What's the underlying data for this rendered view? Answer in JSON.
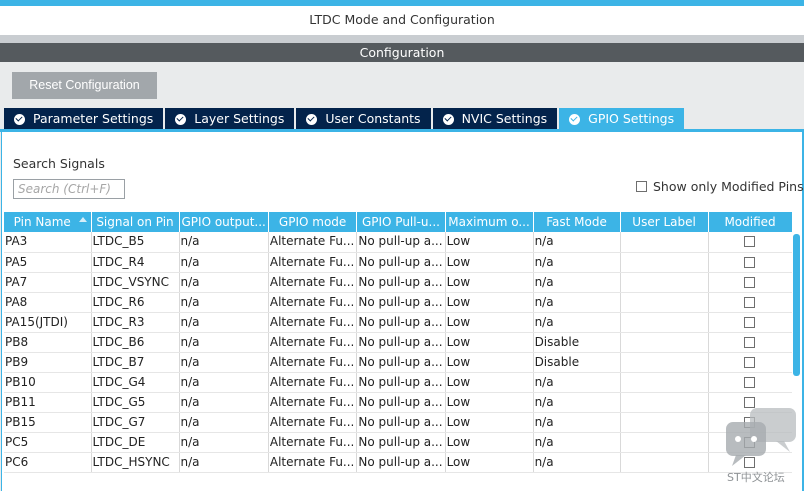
{
  "window": {
    "title": "LTDC Mode and Configuration"
  },
  "config_bar": {
    "label": "Configuration"
  },
  "toolbar": {
    "reset_label": "Reset Configuration"
  },
  "tabs": [
    {
      "label": "Parameter Settings",
      "active": false
    },
    {
      "label": "Layer Settings",
      "active": false
    },
    {
      "label": "User Constants",
      "active": false
    },
    {
      "label": "NVIC Settings",
      "active": false
    },
    {
      "label": "GPIO Settings",
      "active": true
    }
  ],
  "search": {
    "label": "Search Signals",
    "placeholder": "Search (Ctrl+F)",
    "value": ""
  },
  "filter": {
    "show_only_modified_label": "Show only Modified Pins",
    "checked": false
  },
  "table": {
    "columns": [
      "Pin Name",
      "Signal on Pin",
      "GPIO output...",
      "GPIO mode",
      "GPIO Pull-u...",
      "Maximum o...",
      "Fast Mode",
      "User Label",
      "Modified"
    ],
    "rows": [
      [
        "PA3",
        "LTDC_B5",
        "n/a",
        "Alternate Fu...",
        "No pull-up a...",
        "Low",
        "n/a",
        "",
        false
      ],
      [
        "PA5",
        "LTDC_R4",
        "n/a",
        "Alternate Fu...",
        "No pull-up a...",
        "Low",
        "n/a",
        "",
        false
      ],
      [
        "PA7",
        "LTDC_VSYNC",
        "n/a",
        "Alternate Fu...",
        "No pull-up a...",
        "Low",
        "n/a",
        "",
        false
      ],
      [
        "PA8",
        "LTDC_R6",
        "n/a",
        "Alternate Fu...",
        "No pull-up a...",
        "Low",
        "n/a",
        "",
        false
      ],
      [
        "PA15(JTDI)",
        "LTDC_R3",
        "n/a",
        "Alternate Fu...",
        "No pull-up a...",
        "Low",
        "n/a",
        "",
        false
      ],
      [
        "PB8",
        "LTDC_B6",
        "n/a",
        "Alternate Fu...",
        "No pull-up a...",
        "Low",
        "Disable",
        "",
        false
      ],
      [
        "PB9",
        "LTDC_B7",
        "n/a",
        "Alternate Fu...",
        "No pull-up a...",
        "Low",
        "Disable",
        "",
        false
      ],
      [
        "PB10",
        "LTDC_G4",
        "n/a",
        "Alternate Fu...",
        "No pull-up a...",
        "Low",
        "n/a",
        "",
        false
      ],
      [
        "PB11",
        "LTDC_G5",
        "n/a",
        "Alternate Fu...",
        "No pull-up a...",
        "Low",
        "n/a",
        "",
        false
      ],
      [
        "PB15",
        "LTDC_G7",
        "n/a",
        "Alternate Fu...",
        "No pull-up a...",
        "Low",
        "n/a",
        "",
        false
      ],
      [
        "PC5",
        "LTDC_DE",
        "n/a",
        "Alternate Fu...",
        "No pull-up a...",
        "Low",
        "n/a",
        "",
        false
      ],
      [
        "PC6",
        "LTDC_HSYNC",
        "n/a",
        "Alternate Fu...",
        "No pull-up a...",
        "Low",
        "n/a",
        "",
        false
      ]
    ]
  },
  "watermark": {
    "text": "ST中文论坛"
  },
  "colors": {
    "accent": "#3cb4e6",
    "tab_dark": "#03234b",
    "config_bar": "#555a5e",
    "button_gray": "#a2a7ab"
  }
}
